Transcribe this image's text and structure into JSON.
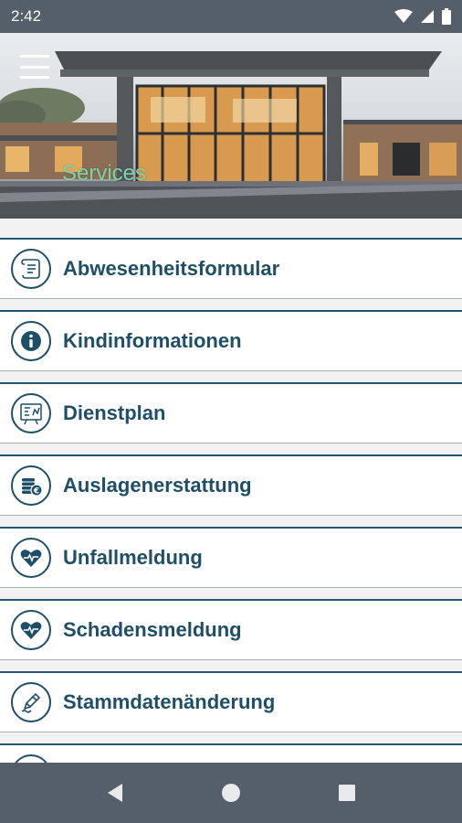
{
  "status_bar": {
    "time": "2:42",
    "icons": [
      "wifi-icon",
      "cell-signal-icon",
      "battery-icon"
    ]
  },
  "header": {
    "title": "Services",
    "menu_icon": "hamburger-menu-icon",
    "image": "building-photo"
  },
  "services": [
    {
      "label": "Abwesenheitsformular",
      "icon": "form-scroll-icon"
    },
    {
      "label": "Kindinformationen",
      "icon": "info-icon"
    },
    {
      "label": "Dienstplan",
      "icon": "schedule-board-icon"
    },
    {
      "label": "Auslagenerstattung",
      "icon": "coins-euro-icon"
    },
    {
      "label": "Unfallmeldung",
      "icon": "heart-pulse-icon"
    },
    {
      "label": "Schadensmeldung",
      "icon": "heart-pulse-icon"
    },
    {
      "label": "Stammdatenänderung",
      "icon": "pen-edit-icon"
    }
  ],
  "nav_bar": {
    "back": "back-triangle-icon",
    "home": "home-circle-icon",
    "recents": "recents-square-icon"
  },
  "colors": {
    "accent": "#1f4f66",
    "title_green": "#7dd3a7",
    "system_bar": "#545f69"
  }
}
